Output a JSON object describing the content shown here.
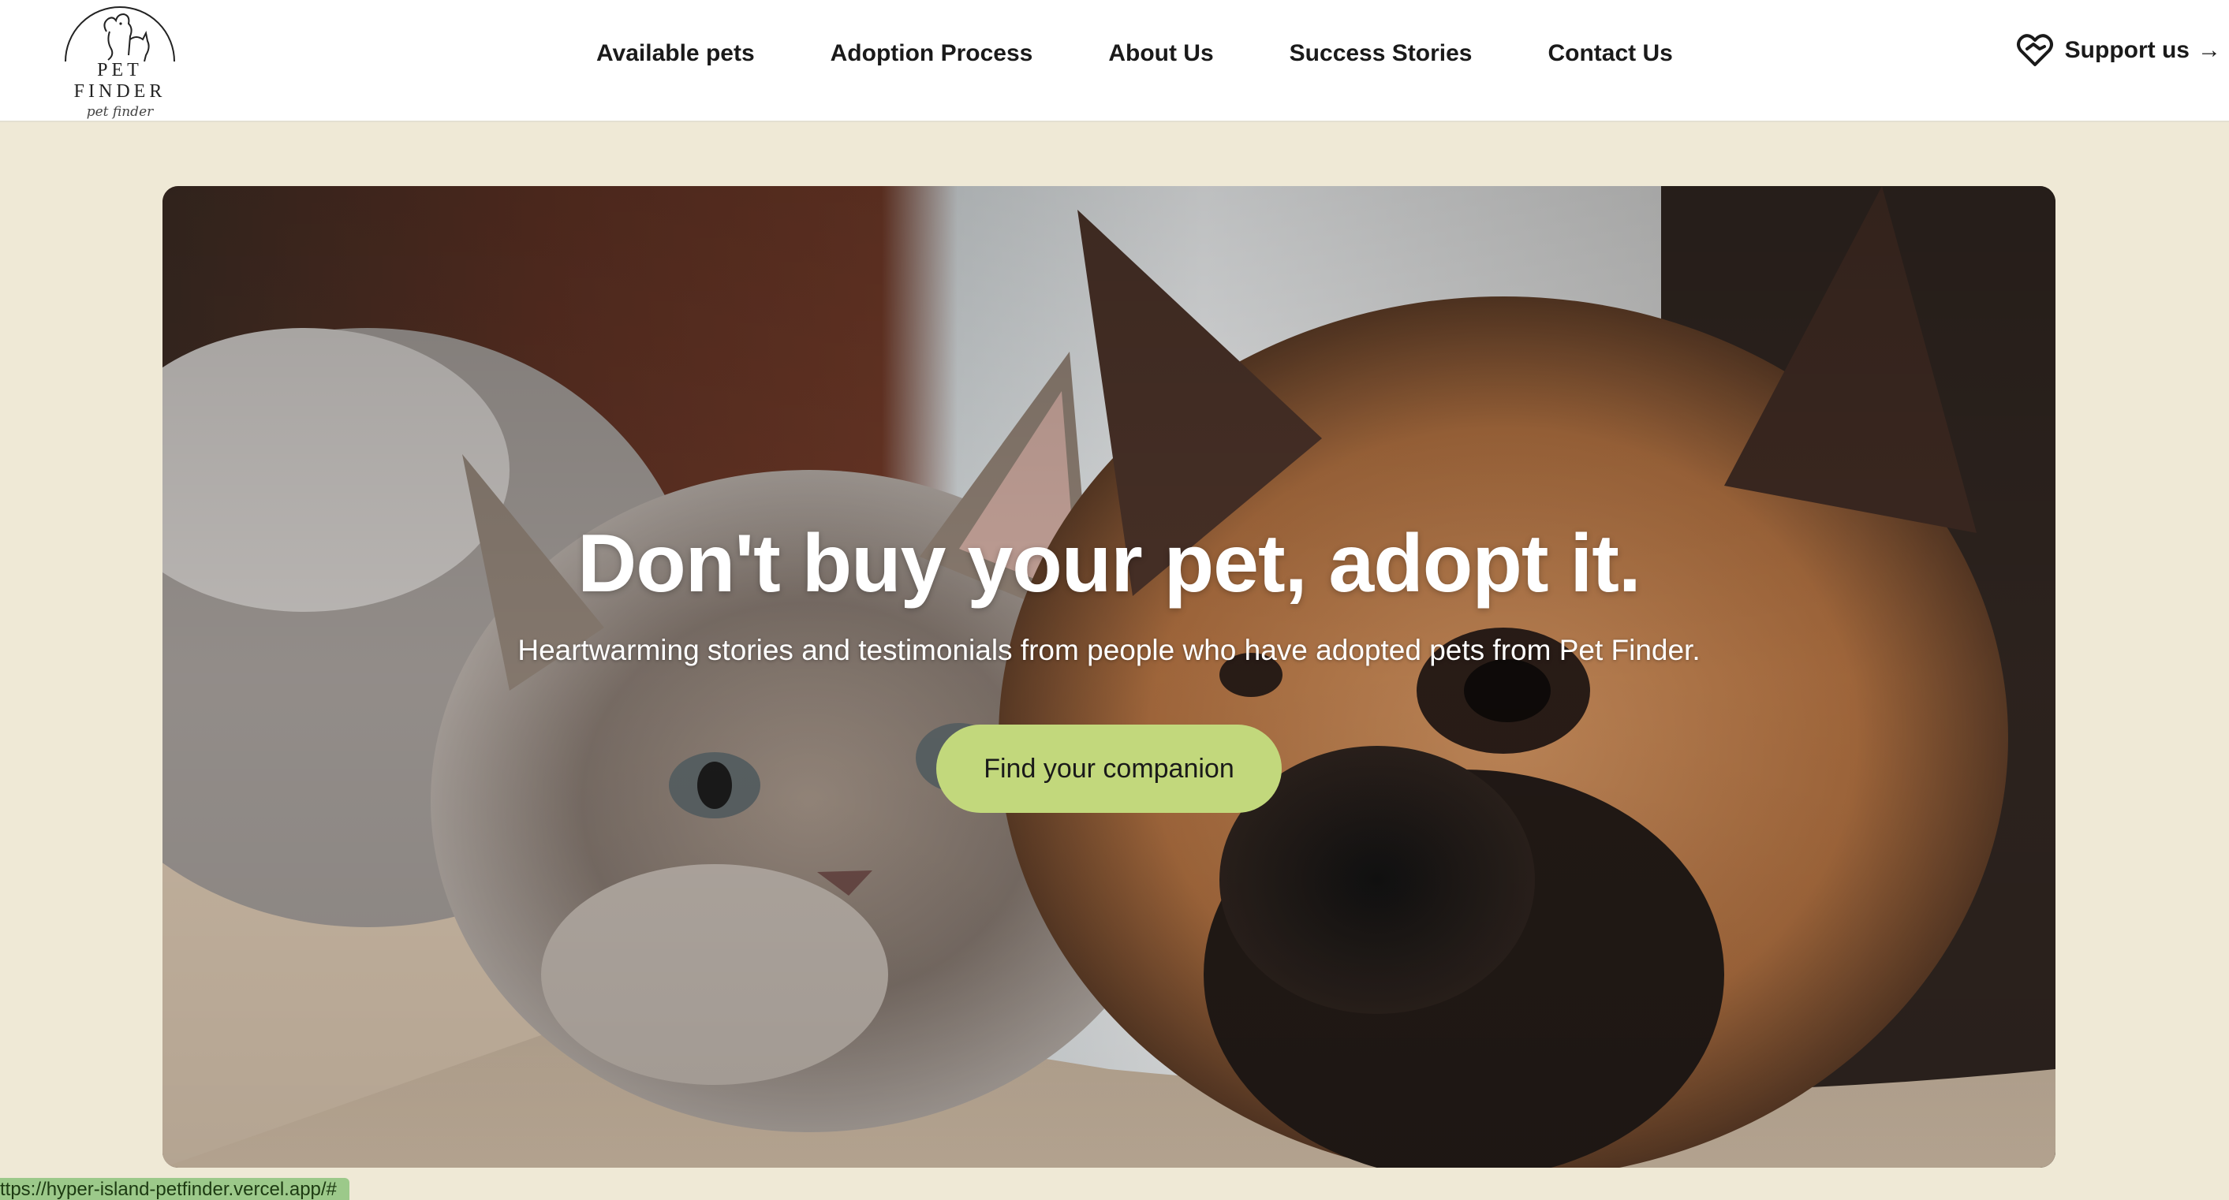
{
  "header": {
    "logo": {
      "title": "PET FINDER",
      "subtitle": "pet finder"
    },
    "nav": [
      {
        "label": "Available pets"
      },
      {
        "label": "Adoption Process"
      },
      {
        "label": "About Us"
      },
      {
        "label": "Success Stories"
      },
      {
        "label": "Contact Us"
      }
    ],
    "support": {
      "label": "Support us",
      "arrow": "→",
      "icon": "heart-handshake-icon"
    }
  },
  "hero": {
    "title": "Don't buy your pet, adopt it.",
    "subtitle": "Heartwarming stories and testimonials from people who have adopted pets from Pet Finder.",
    "cta_label": "Find your companion"
  },
  "status_bar": {
    "url": "ttps://hyper-island-petfinder.vercel.app/#"
  },
  "colors": {
    "page_bg": "#efe9d6",
    "header_bg": "#ffffff",
    "cta_bg": "#c2d87c",
    "status_bg": "#9cc98a"
  }
}
